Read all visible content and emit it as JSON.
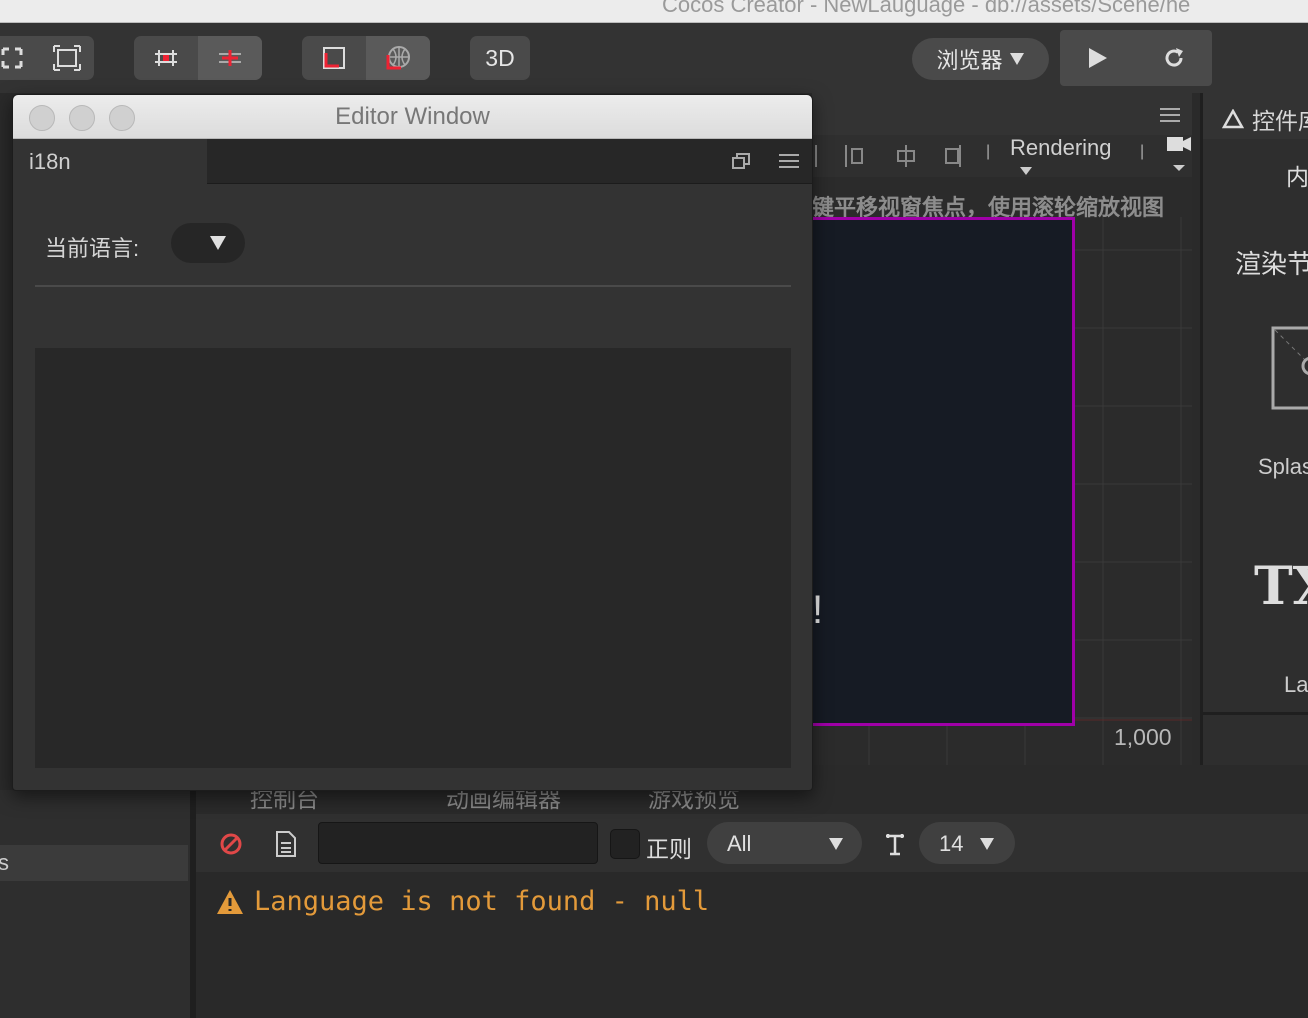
{
  "app": {
    "title": "Cocos Creator - NewLauguage - db://assets/Scene/he"
  },
  "toolbar": {
    "btn_3d_label": "3D",
    "platform_select": "浏览器",
    "play_icon": "play-icon",
    "refresh_icon": "refresh-icon"
  },
  "scene": {
    "mode_select": "Rendering",
    "hint_text": "键平移视窗焦点，使用滚轮缩放视图",
    "canvas_text": "!",
    "axis_label": "1,000",
    "canvas_border_color": "#a000a8"
  },
  "right_panel": {
    "tab_label": "控件库",
    "section_label": "内",
    "render_label": "渲染节",
    "item1_label": "Splas",
    "item2_glyph": "TX",
    "item2_label": "La"
  },
  "editor_window": {
    "title": "Editor Window",
    "tab_label": "i18n",
    "language_label": "当前语言:",
    "language_value": ""
  },
  "bottom": {
    "left_item_label": "s",
    "tabs": [
      "控制台",
      "动画编辑器",
      "游戏预览"
    ]
  },
  "console": {
    "filter_value": "",
    "regex_label": "正则",
    "level_select": "All",
    "font_size": "14",
    "log_message": "Language is not found - null",
    "warning_color": "#e39a3a"
  }
}
